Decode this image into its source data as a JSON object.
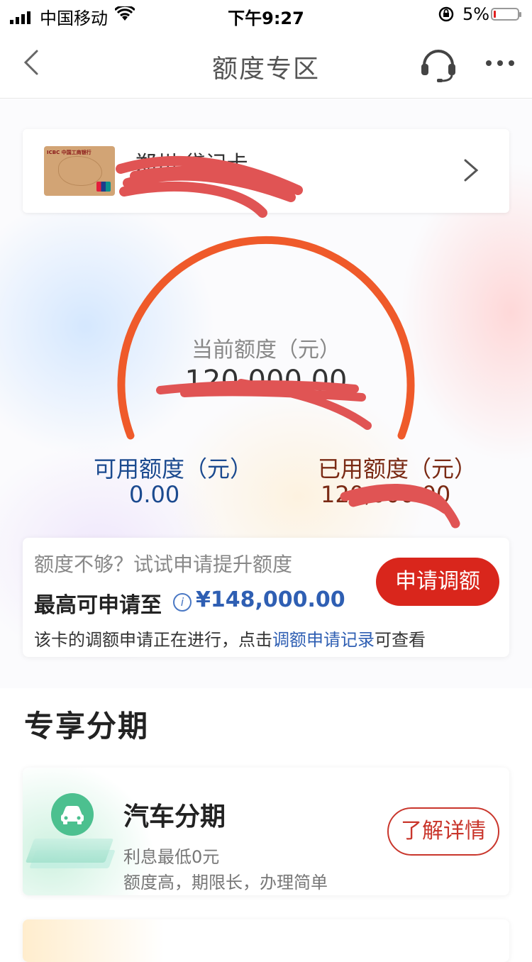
{
  "status_bar": {
    "carrier": "中国移动",
    "time": "下午9:27",
    "battery": "5%",
    "battery_color": "#e02020"
  },
  "nav": {
    "title": "额度专区",
    "back_icon": "chevron-left-icon",
    "service_icon": "headset-icon",
    "more_icon": "ellipsis-icon"
  },
  "card": {
    "name": "郑州 贷记卡",
    "bank_mark": "ICBC 中国工商银行"
  },
  "gauge": {
    "current_label": "当前额度（元）",
    "current_value": "120,000.00",
    "arc_color": "#ef5a2a"
  },
  "available": {
    "label": "可用额度（元）",
    "value": "0.00"
  },
  "used": {
    "label": "已用额度（元）",
    "value": "120,000.00"
  },
  "limit_box": {
    "question": "额度不够？试试申请提升额度",
    "max_label": "最高可申请至",
    "max_amount": "¥148,000.00",
    "apply_button": "申请调额",
    "note_prefix": "该卡的调额申请正在进行，点击",
    "note_link": "调额申请记录",
    "note_suffix": "可查看"
  },
  "section": {
    "title": "专享分期"
  },
  "installment": {
    "name": "汽车分期",
    "line1": "利息最低0元",
    "line2": "额度高，期限长，办理简单",
    "button": "了解详情",
    "icon": "car-icon"
  },
  "colors": {
    "primary_red": "#d9261c",
    "link_blue": "#2f5fb3",
    "available_blue": "#1b4a8f",
    "used_brown": "#7a2a14"
  }
}
